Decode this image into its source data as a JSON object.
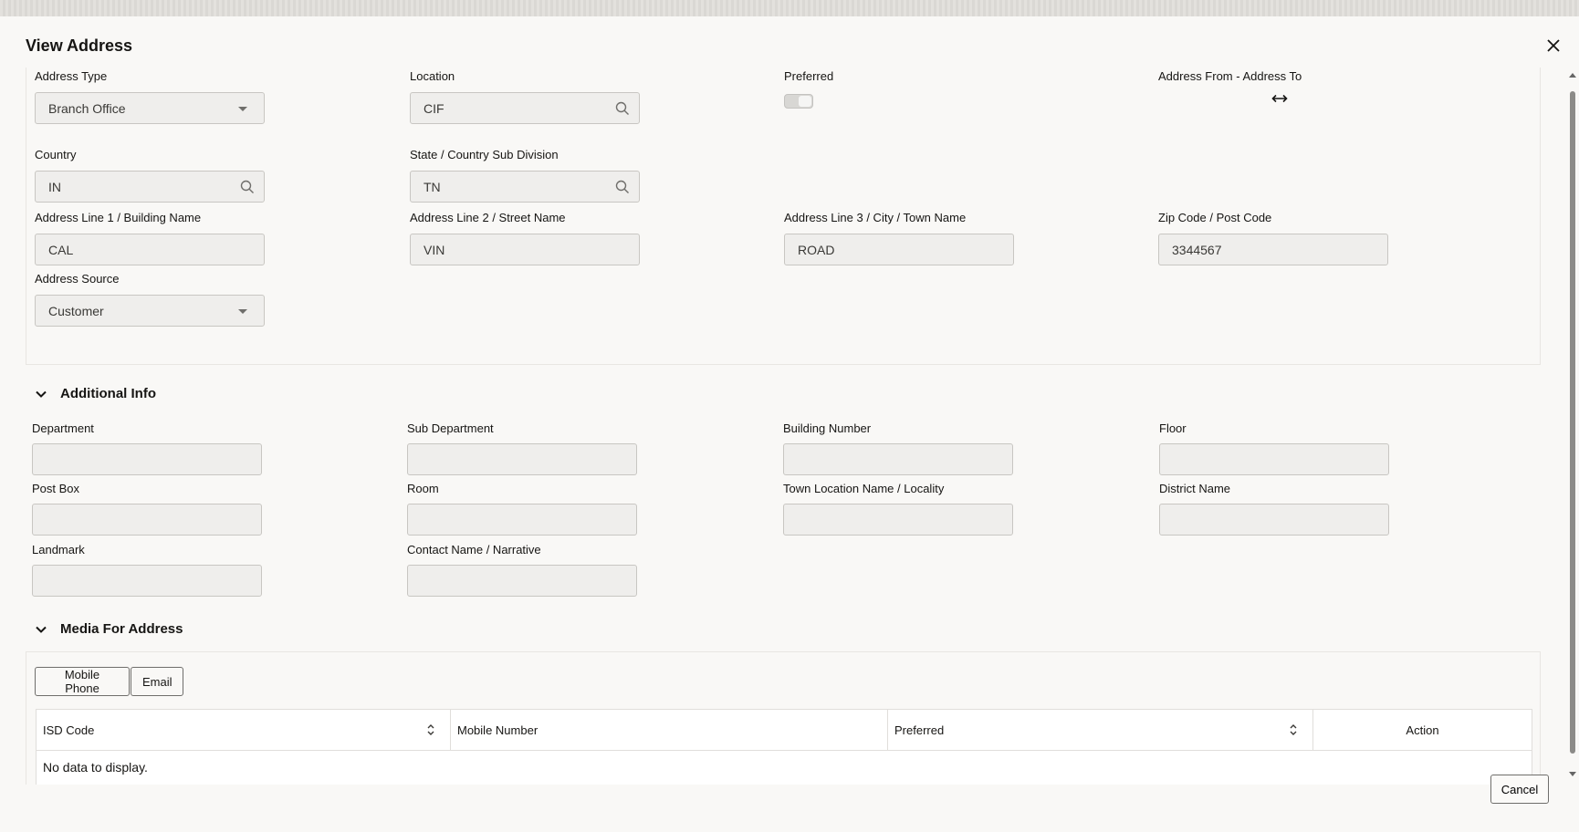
{
  "dialog": {
    "title": "View Address",
    "close_icon": "close-icon"
  },
  "address": {
    "address_type": {
      "label": "Address Type",
      "value": "Branch Office"
    },
    "location": {
      "label": "Location",
      "value": "CIF"
    },
    "preferred": {
      "label": "Preferred",
      "checked": true
    },
    "address_from_to": {
      "label": "Address From - Address To",
      "icon": "left-right-arrow-icon"
    },
    "country": {
      "label": "Country",
      "value": "IN"
    },
    "state": {
      "label": "State / Country Sub Division",
      "value": "TN"
    },
    "line1": {
      "label": "Address Line 1 / Building Name",
      "value": "CAL"
    },
    "line2": {
      "label": "Address Line 2 / Street Name",
      "value": "VIN"
    },
    "line3": {
      "label": "Address Line 3 / City / Town Name",
      "value": "ROAD"
    },
    "zip": {
      "label": "Zip Code / Post Code",
      "value": "3344567"
    },
    "source": {
      "label": "Address Source",
      "value": "Customer"
    }
  },
  "additional_info": {
    "title": "Additional Info",
    "department": {
      "label": "Department",
      "value": ""
    },
    "sub_department": {
      "label": "Sub Department",
      "value": ""
    },
    "building_number": {
      "label": "Building Number",
      "value": ""
    },
    "floor": {
      "label": "Floor",
      "value": ""
    },
    "post_box": {
      "label": "Post Box",
      "value": ""
    },
    "room": {
      "label": "Room",
      "value": ""
    },
    "town_location": {
      "label": "Town Location Name / Locality",
      "value": ""
    },
    "district": {
      "label": "District Name",
      "value": ""
    },
    "landmark": {
      "label": "Landmark",
      "value": ""
    },
    "contact_name": {
      "label": "Contact Name / Narrative",
      "value": ""
    }
  },
  "media": {
    "title": "Media For Address",
    "tabs": [
      "Mobile Phone",
      "Email"
    ],
    "columns": [
      "ISD Code",
      "Mobile Number",
      "Preferred",
      "Action"
    ],
    "empty_text": "No data to display."
  },
  "footer": {
    "cancel_label": "Cancel"
  }
}
